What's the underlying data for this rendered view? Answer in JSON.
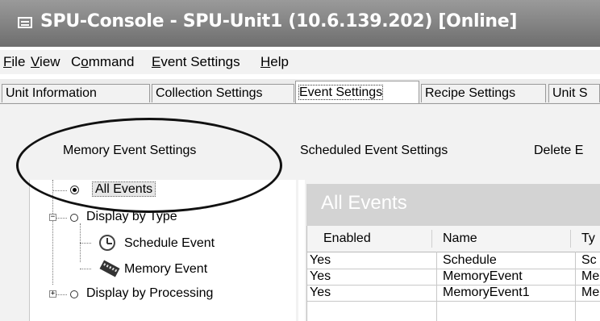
{
  "window": {
    "title": "SPU-Console - SPU-Unit1 (10.6.139.202) [Online]"
  },
  "menu": [
    {
      "first": "F",
      "rest": "ile"
    },
    {
      "first": "V",
      "rest": "iew"
    },
    {
      "pre": "C",
      "first": "o",
      "rest": "mmand"
    },
    {
      "first": "E",
      "rest": "vent Settings"
    },
    {
      "first": "H",
      "rest": "elp"
    }
  ],
  "tabs": [
    "Unit Information",
    "Collection Settings",
    "Event Settings",
    "Recipe Settings",
    "Unit S"
  ],
  "active_tab": "Event Settings",
  "subtoolbar": [
    "Memory Event Settings",
    "Scheduled Event Settings",
    "Delete E"
  ],
  "tree": {
    "all_events": "All Events",
    "display_by_type": "Display by Type",
    "schedule_event": "Schedule Event",
    "memory_event": "Memory Event",
    "display_by_processing": "Display by Processing"
  },
  "panel": {
    "header": "All Events",
    "columns": [
      "Enabled",
      "Name",
      "Ty"
    ],
    "rows": [
      [
        "Yes",
        "Schedule",
        "Sc"
      ],
      [
        "Yes",
        "MemoryEvent",
        "Me"
      ],
      [
        "Yes",
        "MemoryEvent1",
        "Me"
      ]
    ]
  },
  "icons": {
    "app": "console-icon",
    "schedule": "clock-icon",
    "memory": "memory-chip-icon"
  },
  "colors": {
    "titlebar": "#7a7a7a",
    "header_band": "#d3d3d3",
    "highlight_ellipse": "#111111"
  }
}
